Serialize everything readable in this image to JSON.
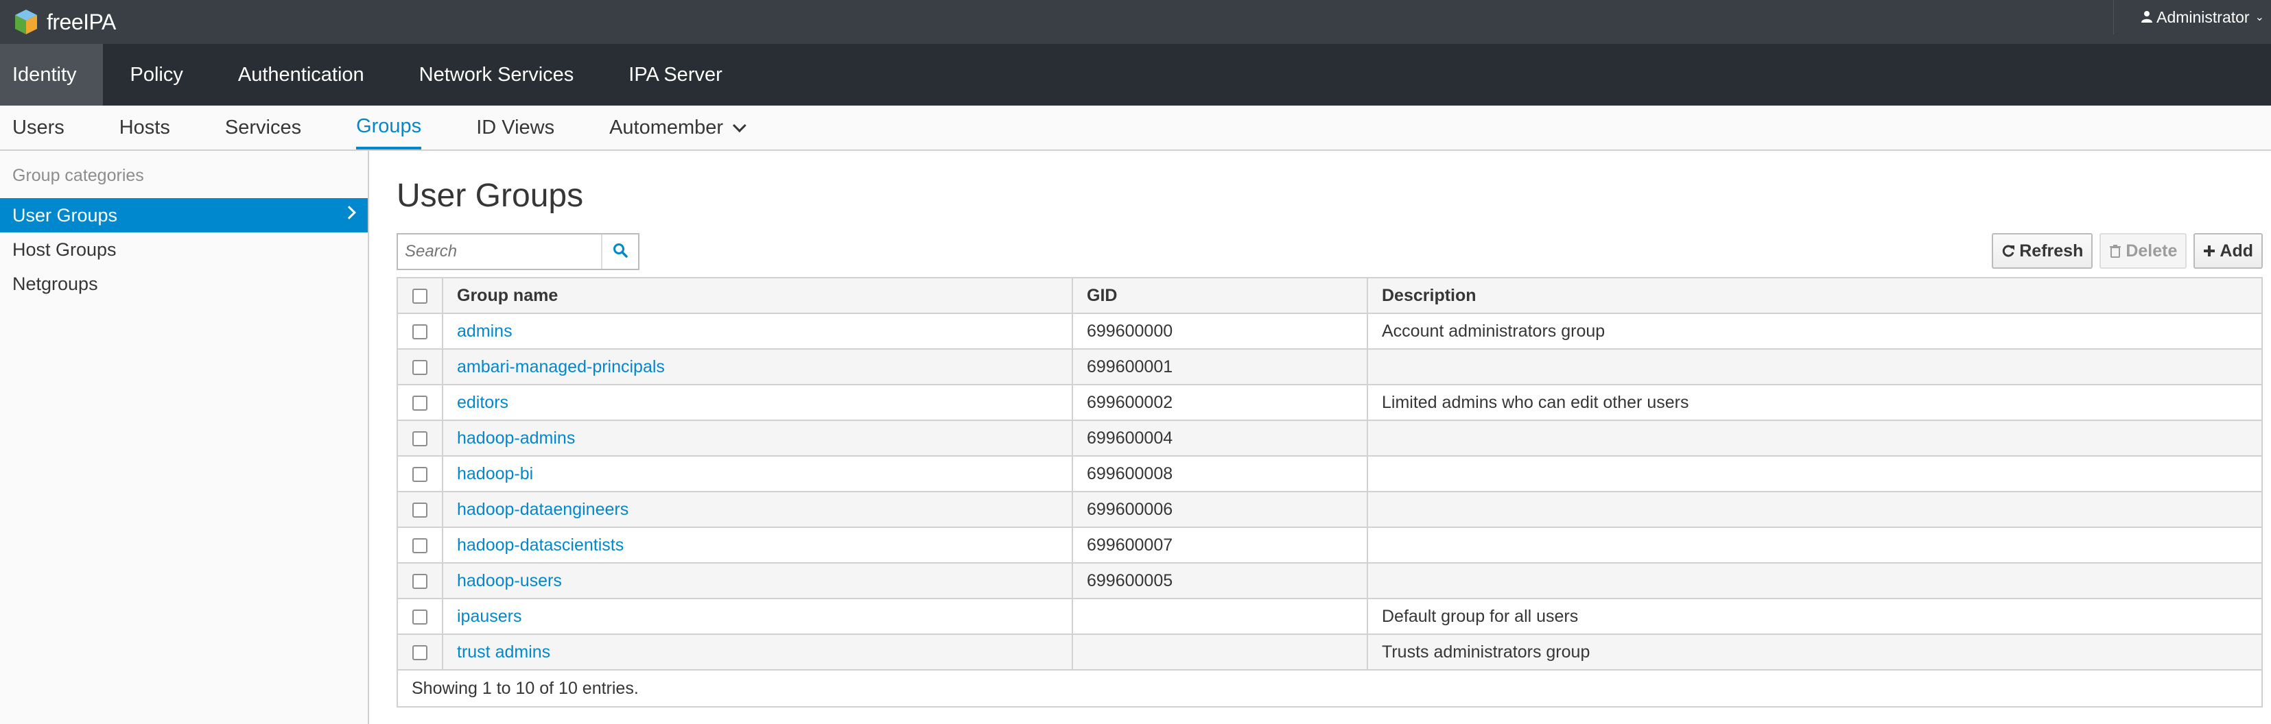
{
  "masthead": {
    "brand": "freeIPA",
    "user": "Administrator"
  },
  "primary_nav": [
    "Identity",
    "Policy",
    "Authentication",
    "Network Services",
    "IPA Server"
  ],
  "secondary_nav": [
    "Users",
    "Hosts",
    "Services",
    "Groups",
    "ID Views",
    "Automember"
  ],
  "sidebar": {
    "heading": "Group categories",
    "items": [
      "User Groups",
      "Host Groups",
      "Netgroups"
    ]
  },
  "main": {
    "title": "User Groups",
    "search_placeholder": "Search",
    "buttons": {
      "refresh": "Refresh",
      "delete": "Delete",
      "add": "Add"
    },
    "columns": [
      "Group name",
      "GID",
      "Description"
    ],
    "rows": [
      {
        "name": "admins",
        "gid": "699600000",
        "description": "Account administrators group"
      },
      {
        "name": "ambari-managed-principals",
        "gid": "699600001",
        "description": ""
      },
      {
        "name": "editors",
        "gid": "699600002",
        "description": "Limited admins who can edit other users"
      },
      {
        "name": "hadoop-admins",
        "gid": "699600004",
        "description": ""
      },
      {
        "name": "hadoop-bi",
        "gid": "699600008",
        "description": ""
      },
      {
        "name": "hadoop-dataengineers",
        "gid": "699600006",
        "description": ""
      },
      {
        "name": "hadoop-datascientists",
        "gid": "699600007",
        "description": ""
      },
      {
        "name": "hadoop-users",
        "gid": "699600005",
        "description": ""
      },
      {
        "name": "ipausers",
        "gid": "",
        "description": "Default group for all users"
      },
      {
        "name": "trust admins",
        "gid": "",
        "description": "Trusts administrators group"
      }
    ],
    "footer": "Showing 1 to 10 of 10 entries."
  },
  "colors": {
    "accent": "#0088ce",
    "masthead": "#393f44",
    "nav": "#292e34",
    "nav_active": "#4d5258"
  }
}
